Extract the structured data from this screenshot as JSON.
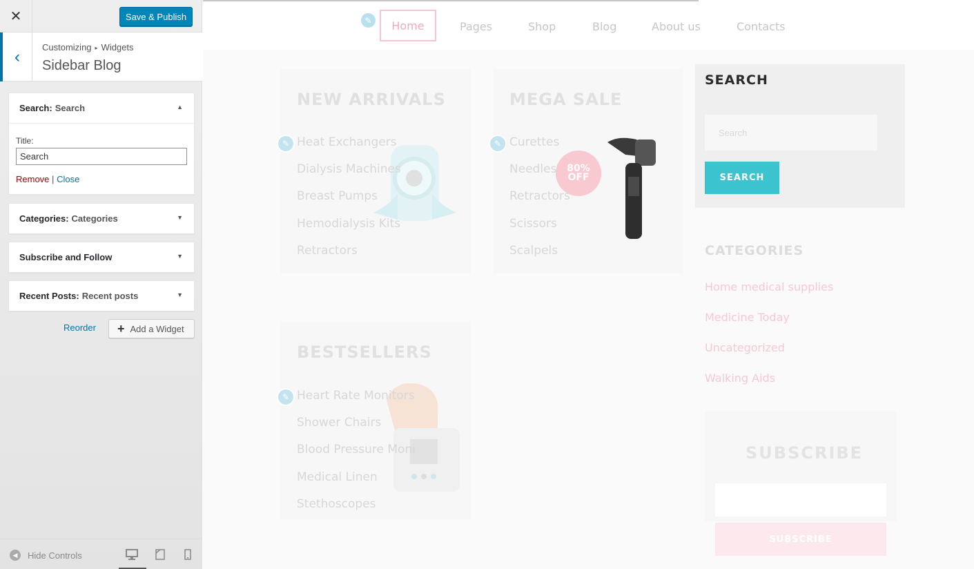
{
  "customizer": {
    "close_glyph": "✕",
    "save_label": "Save & Publish",
    "back_glyph": "‹",
    "breadcrumb_root": "Customizing",
    "breadcrumb_sep": "▸",
    "breadcrumb_child": "Widgets",
    "section_title": "Sidebar Blog",
    "widgets": [
      {
        "name": "Search:",
        "subtitle": "Search",
        "expanded": true,
        "toggle": "▲"
      },
      {
        "name": "Categories:",
        "subtitle": "Categories",
        "expanded": false,
        "toggle": "▼"
      },
      {
        "name": "Subscribe and Follow",
        "subtitle": "",
        "expanded": false,
        "toggle": "▼"
      },
      {
        "name": "Recent Posts:",
        "subtitle": "Recent posts",
        "expanded": false,
        "toggle": "▼"
      }
    ],
    "search_widget_form": {
      "title_label": "Title:",
      "title_value": "Search",
      "remove_label": "Remove",
      "separator": "|",
      "close_label": "Close"
    },
    "reorder_label": "Reorder",
    "add_widget_label": "Add a Widget",
    "add_widget_glyph": "+",
    "hide_controls_label": "Hide Controls",
    "device_preview": {
      "selected": "desktop",
      "options": [
        "desktop",
        "tablet",
        "mobile"
      ]
    },
    "accent_color": "#0085ba"
  },
  "preview": {
    "nav": [
      "Home",
      "Pages",
      "Shop",
      "Blog",
      "About us",
      "Contacts"
    ],
    "nav_active": "Home",
    "new_arrivals": {
      "title": "NEW ARRIVALS",
      "items": [
        "Heat Exchangers",
        "Dialysis Machines",
        "Breast Pumps",
        "Hemodialysis Kits",
        "Retractors"
      ]
    },
    "mega_sale": {
      "title": "MEGA SALE",
      "items": [
        "Curettes",
        "Needles",
        "Retractors",
        "Scissors",
        "Scalpels"
      ],
      "badge_line1": "80%",
      "badge_line2": "OFF"
    },
    "bestsellers": {
      "title": "BESTSELLERS",
      "items": [
        "Heart Rate Monitors",
        "Shower Chairs",
        "Blood Pressure Moni",
        "Medical Linen",
        "Stethoscopes"
      ]
    },
    "search_widget": {
      "title": "SEARCH",
      "placeholder": "Search",
      "button": "SEARCH",
      "button_color": "#3bc4cf"
    },
    "categories": {
      "title": "CATEGORIES",
      "links": [
        "Home medical supplies",
        "Medicine Today",
        "Uncategorized",
        "Walking Aids"
      ]
    },
    "subscribe": {
      "title": "SUBSCRIBE",
      "button": "SUBSCRIBE"
    },
    "brand_color": "#f3aab9"
  }
}
